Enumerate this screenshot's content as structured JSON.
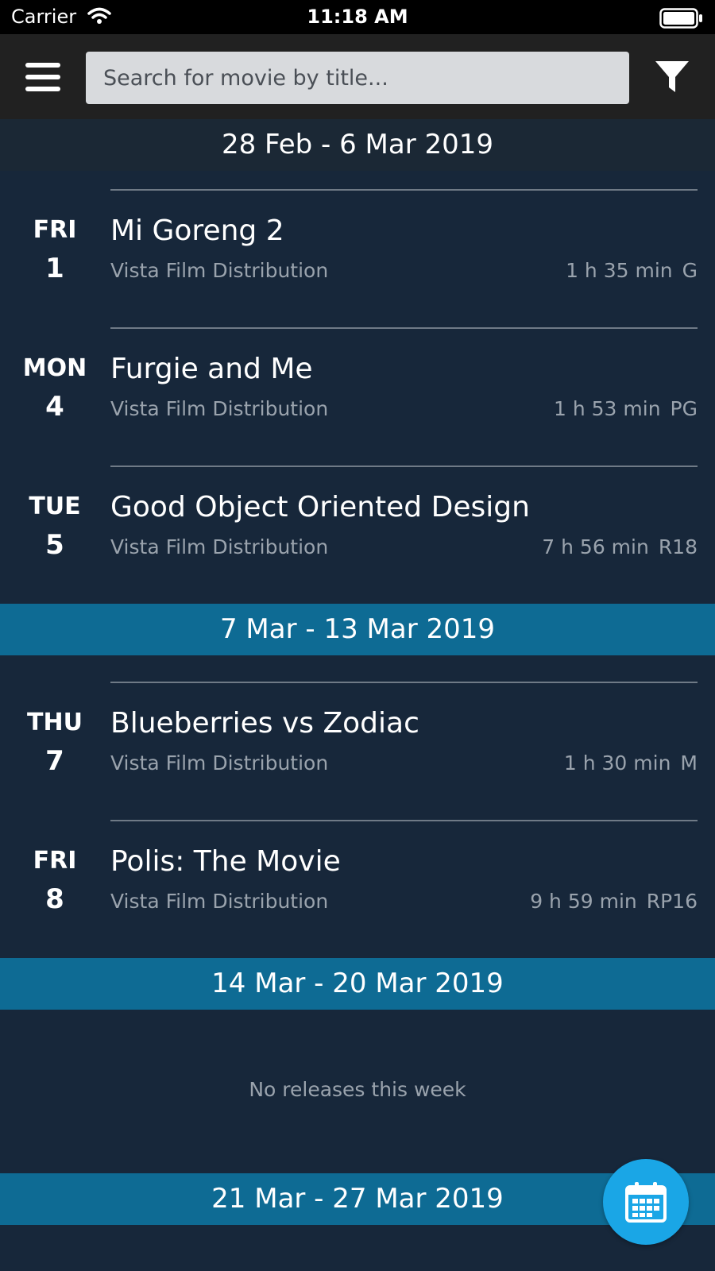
{
  "status_bar": {
    "carrier": "Carrier",
    "time": "11:18 AM"
  },
  "header": {
    "search_placeholder": "Search for movie by title..."
  },
  "weeks": [
    {
      "label": "28 Feb - 6 Mar 2019",
      "movies": [
        {
          "day": "FRI",
          "date": "1",
          "title": "Mi Goreng 2",
          "distributor": "Vista Film Distribution",
          "duration": "1 h 35 min",
          "rating": "G"
        },
        {
          "day": "MON",
          "date": "4",
          "title": "Furgie and Me",
          "distributor": "Vista Film Distribution",
          "duration": "1 h 53 min",
          "rating": "PG"
        },
        {
          "day": "TUE",
          "date": "5",
          "title": "Good Object Oriented Design",
          "distributor": "Vista Film Distribution",
          "duration": "7 h 56 min",
          "rating": "R18"
        }
      ]
    },
    {
      "label": "7 Mar - 13 Mar 2019",
      "movies": [
        {
          "day": "THU",
          "date": "7",
          "title": "Blueberries vs Zodiac",
          "distributor": "Vista Film Distribution",
          "duration": "1 h 30 min",
          "rating": "M"
        },
        {
          "day": "FRI",
          "date": "8",
          "title": "Polis: The Movie",
          "distributor": "Vista Film Distribution",
          "duration": "9 h 59 min",
          "rating": "RP16"
        }
      ]
    },
    {
      "label": "14 Mar - 20 Mar 2019",
      "empty_message": "No releases this week"
    },
    {
      "label": "21 Mar - 27 Mar 2019"
    }
  ],
  "colors": {
    "header_bg": "#212121",
    "list_bg": "#17273a",
    "week_header_current": "#1b2835",
    "week_header": "#0e6b94",
    "fab": "#1aa6e6",
    "secondary_text": "#9aa3ad"
  },
  "icons": {
    "menu": "hamburger-icon",
    "filter": "filter-funnel-icon",
    "calendar": "calendar-icon",
    "wifi": "wifi-icon",
    "battery": "battery-icon"
  }
}
